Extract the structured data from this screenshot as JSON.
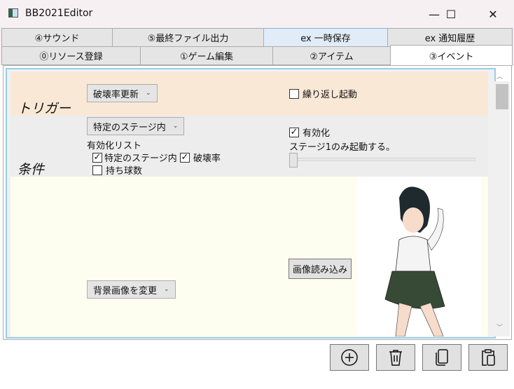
{
  "window": {
    "title": "BB2021Editor",
    "minimize": "—",
    "maximize": "☐",
    "close": "✕"
  },
  "tabs_row1": [
    {
      "label": "④サウンド"
    },
    {
      "label": "⑤最終ファイル出力"
    },
    {
      "label": "ex 一時保存"
    },
    {
      "label": "ex 通知履歴"
    }
  ],
  "tabs_row2": [
    {
      "label": "⓪リソース登録"
    },
    {
      "label": "①ゲーム編集"
    },
    {
      "label": "②アイテム"
    },
    {
      "label": "③イベント"
    }
  ],
  "trigger": {
    "heading": "トリガー",
    "select": "破壊率更新",
    "repeat_label": "繰り返し起動",
    "repeat_checked": false
  },
  "condition": {
    "heading": "条件",
    "select": "特定のステージ内",
    "list_label": "有効化リスト",
    "items": [
      {
        "label": "特定のステージ内",
        "checked": true
      },
      {
        "label": "破壊率",
        "checked": true
      },
      {
        "label": "持ち球数",
        "checked": false
      }
    ],
    "enable_label": "有効化",
    "enable_checked": true,
    "stage_text": "ステージ1のみ起動する。",
    "slider_value": 1
  },
  "image_action": {
    "select": "背景画像を変更",
    "load_button": "画像読み込み"
  },
  "colors": {
    "trigger_bg": "#fae8d6",
    "condition_bg": "#ededed",
    "image_bg": "#fefef0",
    "selected_tab": "#e1ecf8"
  }
}
